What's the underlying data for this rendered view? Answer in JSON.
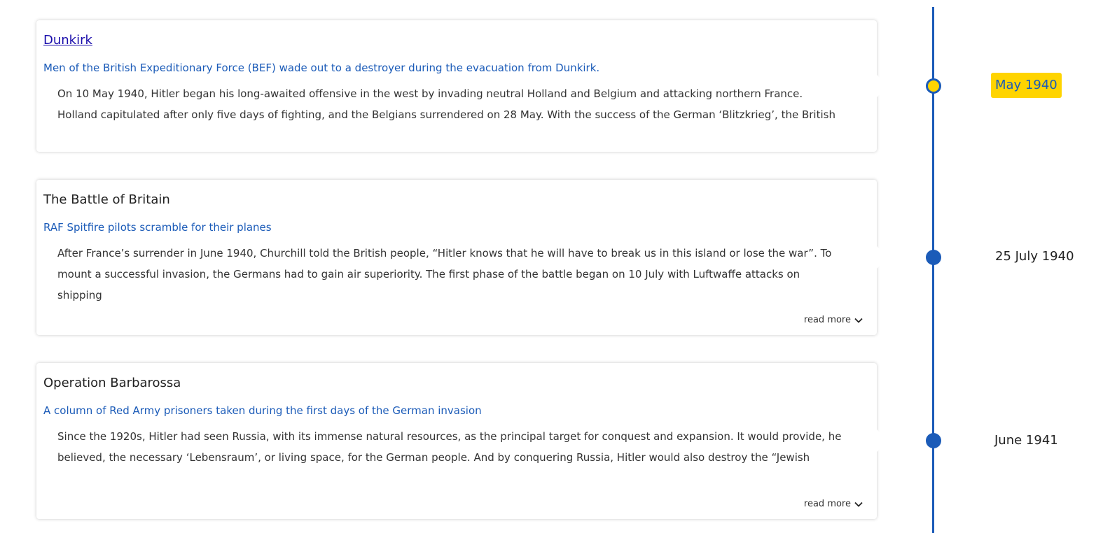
{
  "timeline": {
    "line_color": "#1b5bb8",
    "active_color": "#ffd400",
    "events": [
      {
        "title": "Dunkirk",
        "caption": "Men of the British Expeditionary Force (BEF) wade out to a destroyer during the evacuation from Dunkirk.",
        "text": "On 10 May 1940, Hitler began his long-awaited offensive in the west by invading neutral Holland and Belgium and attacking northern France. Holland capitulated after only five days of fighting, and the Belgians surrendered on 28 May. With the success of the German ‘Blitzkrieg’, the British",
        "date": "May 1940",
        "active": true
      },
      {
        "title": "The Battle of Britain",
        "caption": "RAF Spitfire pilots scramble for their planes",
        "text": "After France’s surrender in June 1940, Churchill told the British people, “Hitler knows that he will have to break us in this island or lose the war”. To mount a successful invasion, the Germans had to gain air superiority. The first phase of the battle began on 10 July with Luftwaffe attacks on shipping",
        "date": "25 July 1940",
        "read_more": "read more",
        "active": false
      },
      {
        "title": "Operation Barbarossa",
        "caption": "A column of Red Army prisoners taken during the first days of the German invasion",
        "text": "Since the 1920s, Hitler had seen Russia, with its immense natural resources, as the principal target for conquest and expansion. It would provide, he believed, the necessary ‘Lebensraum’, or living space, for the German people. And by conquering Russia, Hitler would also destroy the “Jewish",
        "date": "June 1941",
        "read_more": "read more",
        "active": false
      }
    ]
  }
}
